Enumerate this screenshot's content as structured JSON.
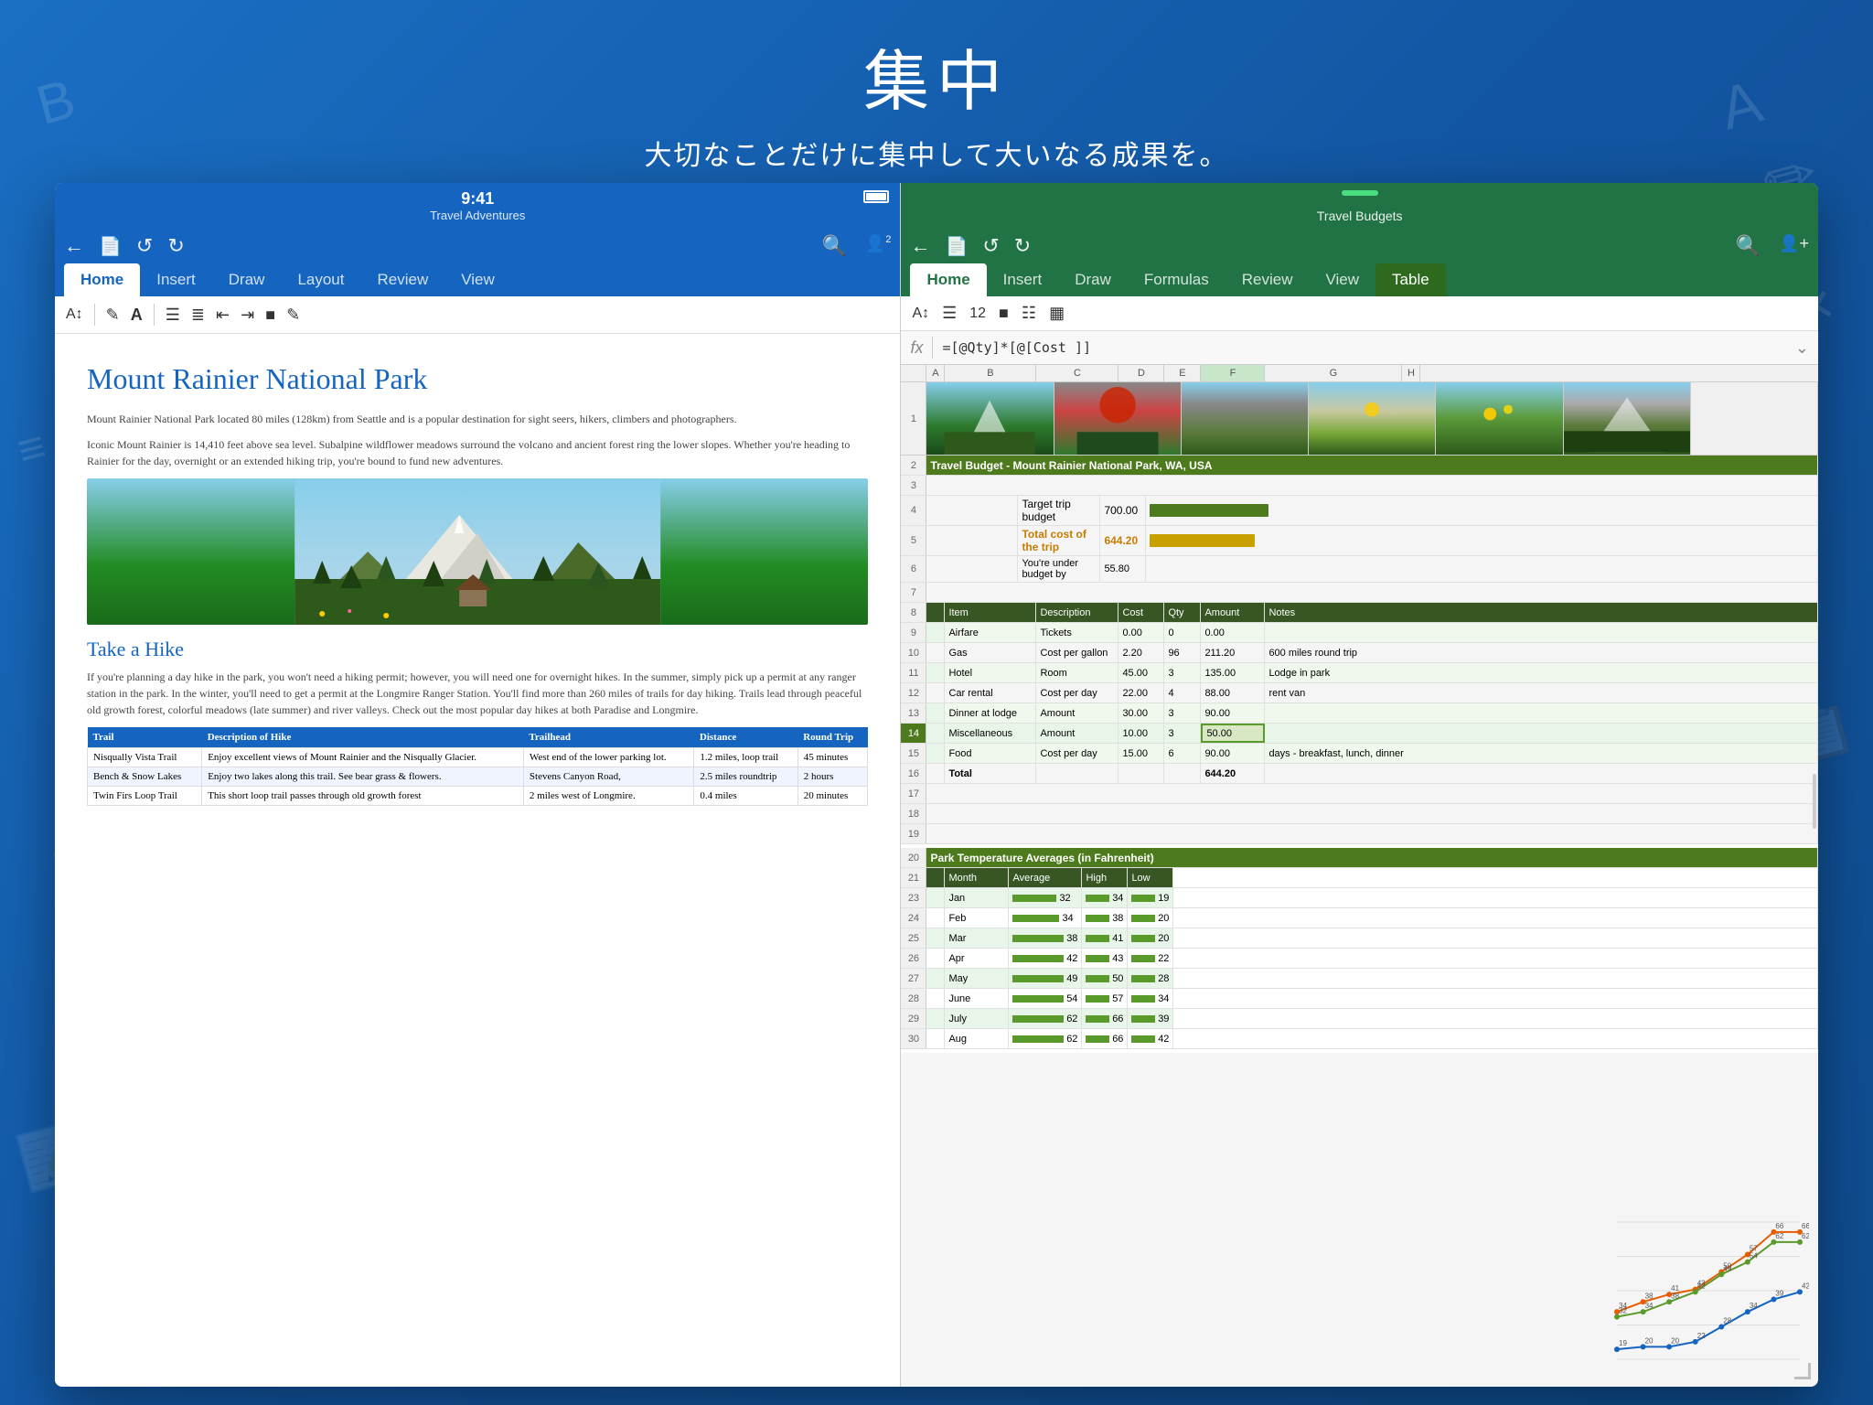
{
  "header": {
    "title": "集中",
    "subtitle": "大切なことだけに集中して大いなる成果を。"
  },
  "word_panel": {
    "status_bar": {
      "time": "9:41",
      "doc_title": "Travel Adventures"
    },
    "toolbar": {
      "back": "←",
      "file": "📄",
      "undo": "↺",
      "redo": "↻",
      "search": "🔍",
      "users": "👤"
    },
    "tabs": [
      "Home",
      "Insert",
      "Draw",
      "Layout",
      "Review",
      "View"
    ],
    "active_tab": "Home",
    "doc": {
      "title": "Mount Rainier National Park",
      "body1": "Mount Rainier National Park located 80 miles (128km) from Seattle and is a popular destination for sight seers, hikers, climbers and photographers.",
      "body2": "Iconic Mount Rainier is 14,410 feet above sea level. Subalpine wildflower meadows surround the volcano and ancient forest ring the lower slopes. Whether you're heading to Rainier for the day, overnight or an extended hiking trip, you're bound to fund new adventures.",
      "section2": "Take a Hike",
      "hike_body": "If you're planning a day hike in the park, you won't need a hiking permit; however, you will need one for overnight hikes. In the summer, simply pick up a permit at any ranger station in the park. In the winter, you'll need to get a permit at the Longmire Ranger Station. You'll find more than 260 miles of trails for day hiking. Trails lead through peaceful old growth forest, colorful meadows (late summer) and river valleys. Check out the most popular day hikes at both Paradise and Longmire."
    },
    "hike_table": {
      "headers": [
        "Trail",
        "Description of Hike",
        "Trailhead",
        "Distance",
        "Round Trip"
      ],
      "rows": [
        [
          "Nisqually Vista Trail",
          "Enjoy excellent views of Mount Rainier and the Nisqually Glacier.",
          "West end of the lower parking lot.",
          "1.2 miles, loop trail",
          "45 minutes"
        ],
        [
          "Bench & Snow Lakes",
          "Enjoy two lakes along this trail. See bear grass & flowers.",
          "Stevens Canyon Road,",
          "2.5 miles roundtrip",
          "2 hours"
        ],
        [
          "Twin Firs Loop Trail",
          "This short loop trail passes through old growth forest",
          "2 miles west of Longmire.",
          "0.4 miles",
          "20 minutes"
        ]
      ]
    }
  },
  "excel_panel": {
    "status_bar": {
      "doc_title": "Travel Budgets"
    },
    "tabs": [
      "Home",
      "Insert",
      "Draw",
      "Formulas",
      "Review",
      "View",
      "Table"
    ],
    "active_tab": "Home",
    "special_tab": "Table",
    "formula": "=[@Qty]*[@[Cost ]]",
    "spreadsheet": {
      "title_row": "Travel Budget - Mount Rainier National Park, WA, USA",
      "budget_rows": [
        {
          "label": "Target trip budget",
          "value": "700.00"
        },
        {
          "label": "Total cost of the trip",
          "value": "644.20"
        },
        {
          "label": "You're under budget by",
          "value": "55.80"
        }
      ],
      "col_headers": [
        "A",
        "B",
        "C",
        "D",
        "E",
        "F",
        "G",
        "H"
      ],
      "item_headers": [
        "Item",
        "Description",
        "Cost",
        "Qty",
        "Amount",
        "Notes"
      ],
      "items": [
        {
          "row": "9",
          "item": "Airfare",
          "desc": "Tickets",
          "cost": "0.00",
          "qty": "0",
          "amount": "0.00",
          "notes": ""
        },
        {
          "row": "10",
          "item": "Gas",
          "desc": "Cost per gallon",
          "cost": "2.20",
          "qty": "96",
          "amount": "211.20",
          "notes": "600 miles round trip"
        },
        {
          "row": "11",
          "item": "Hotel",
          "desc": "Room",
          "cost": "45.00",
          "qty": "3",
          "amount": "135.00",
          "notes": "Lodge in park"
        },
        {
          "row": "12",
          "item": "Car rental",
          "desc": "Cost per day",
          "cost": "22.00",
          "qty": "4",
          "amount": "88.00",
          "notes": "rent van"
        },
        {
          "row": "13",
          "item": "Dinner at lodge",
          "desc": "Amount",
          "cost": "30.00",
          "qty": "3",
          "amount": "90.00",
          "notes": ""
        },
        {
          "row": "14",
          "item": "Miscellaneous",
          "desc": "Amount",
          "cost": "10.00",
          "qty": "3",
          "amount": "50.00",
          "notes": ""
        },
        {
          "row": "15",
          "item": "Food",
          "desc": "Cost per day",
          "cost": "15.00",
          "qty": "6",
          "amount": "90.00",
          "notes": "days - breakfast, lunch, dinner"
        },
        {
          "row": "16",
          "item": "Total",
          "desc": "",
          "cost": "",
          "qty": "",
          "amount": "644.20",
          "notes": ""
        }
      ],
      "temp_table": {
        "title": "Park Temperature Averages (in Fahrenheit)",
        "headers": [
          "Month",
          "Average",
          "High",
          "Low"
        ],
        "rows": [
          [
            "Jan",
            "32",
            "34",
            "19"
          ],
          [
            "Feb",
            "34",
            "38",
            "20"
          ],
          [
            "Mar",
            "38",
            "41",
            "20"
          ],
          [
            "Apr",
            "42",
            "43",
            "22"
          ],
          [
            "May",
            "49",
            "50",
            "28"
          ],
          [
            "June",
            "54",
            "57",
            "34"
          ],
          [
            "July",
            "62",
            "66",
            "39"
          ],
          [
            "Aug",
            "62",
            "66",
            "42"
          ]
        ]
      }
    }
  }
}
